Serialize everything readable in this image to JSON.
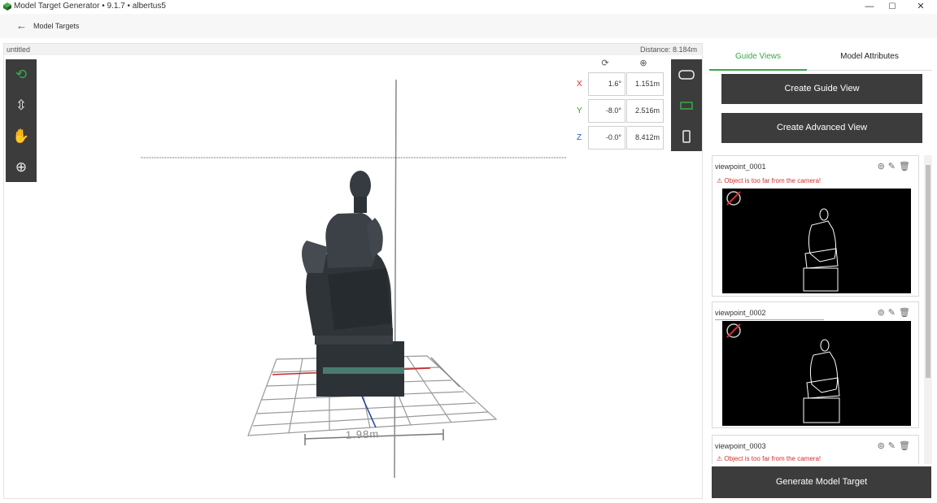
{
  "window": {
    "title": "Model Target Generator • 9.1.7 • albertus5",
    "minimize": "—",
    "maximize": "☐",
    "close": "✕"
  },
  "nav": {
    "back_icon": "←",
    "breadcrumb": "Model Targets"
  },
  "viewport": {
    "model_name": "untitled",
    "distance": "Distance: 8.184m",
    "grid_dimension": "1.98m",
    "tools": {
      "orbit": "⟲",
      "vertical": "⇳",
      "pan": "✋",
      "center": "⊕"
    },
    "coords": {
      "rotation_icon": "⟳",
      "translation_icon": "⊕",
      "rows": [
        {
          "axis": "X",
          "rotation": "1.6°",
          "position": "1.151m",
          "color": "#d32f2f"
        },
        {
          "axis": "Y",
          "rotation": "-8.0°",
          "position": "2.516m",
          "color": "#388e3c"
        },
        {
          "axis": "Z",
          "rotation": "-0.0°",
          "position": "8.412m",
          "color": "#1565c0"
        }
      ]
    },
    "device_icons": {
      "headset": "headset-icon",
      "tablet": "tablet-icon",
      "phone": "phone-icon"
    }
  },
  "panel": {
    "tabs": [
      {
        "label": "Guide Views",
        "active": true
      },
      {
        "label": "Model Attributes",
        "active": false
      }
    ],
    "create_guide_view": "Create Guide View",
    "create_advanced_view": "Create Advanced View",
    "views": [
      {
        "name": "viewpoint_0001",
        "warning": "Object is too far from the camera!"
      },
      {
        "name": "viewpoint_0002",
        "warning": ""
      },
      {
        "name": "viewpoint_0003",
        "warning": "Object is too far from the camera!"
      }
    ],
    "card_icons": "⊚✎🗑",
    "generate": "Generate Model Target"
  },
  "colors": {
    "accent_green": "#3aa84a",
    "dark_button": "#3c3c3c",
    "warning_red": "#d32f2f"
  }
}
